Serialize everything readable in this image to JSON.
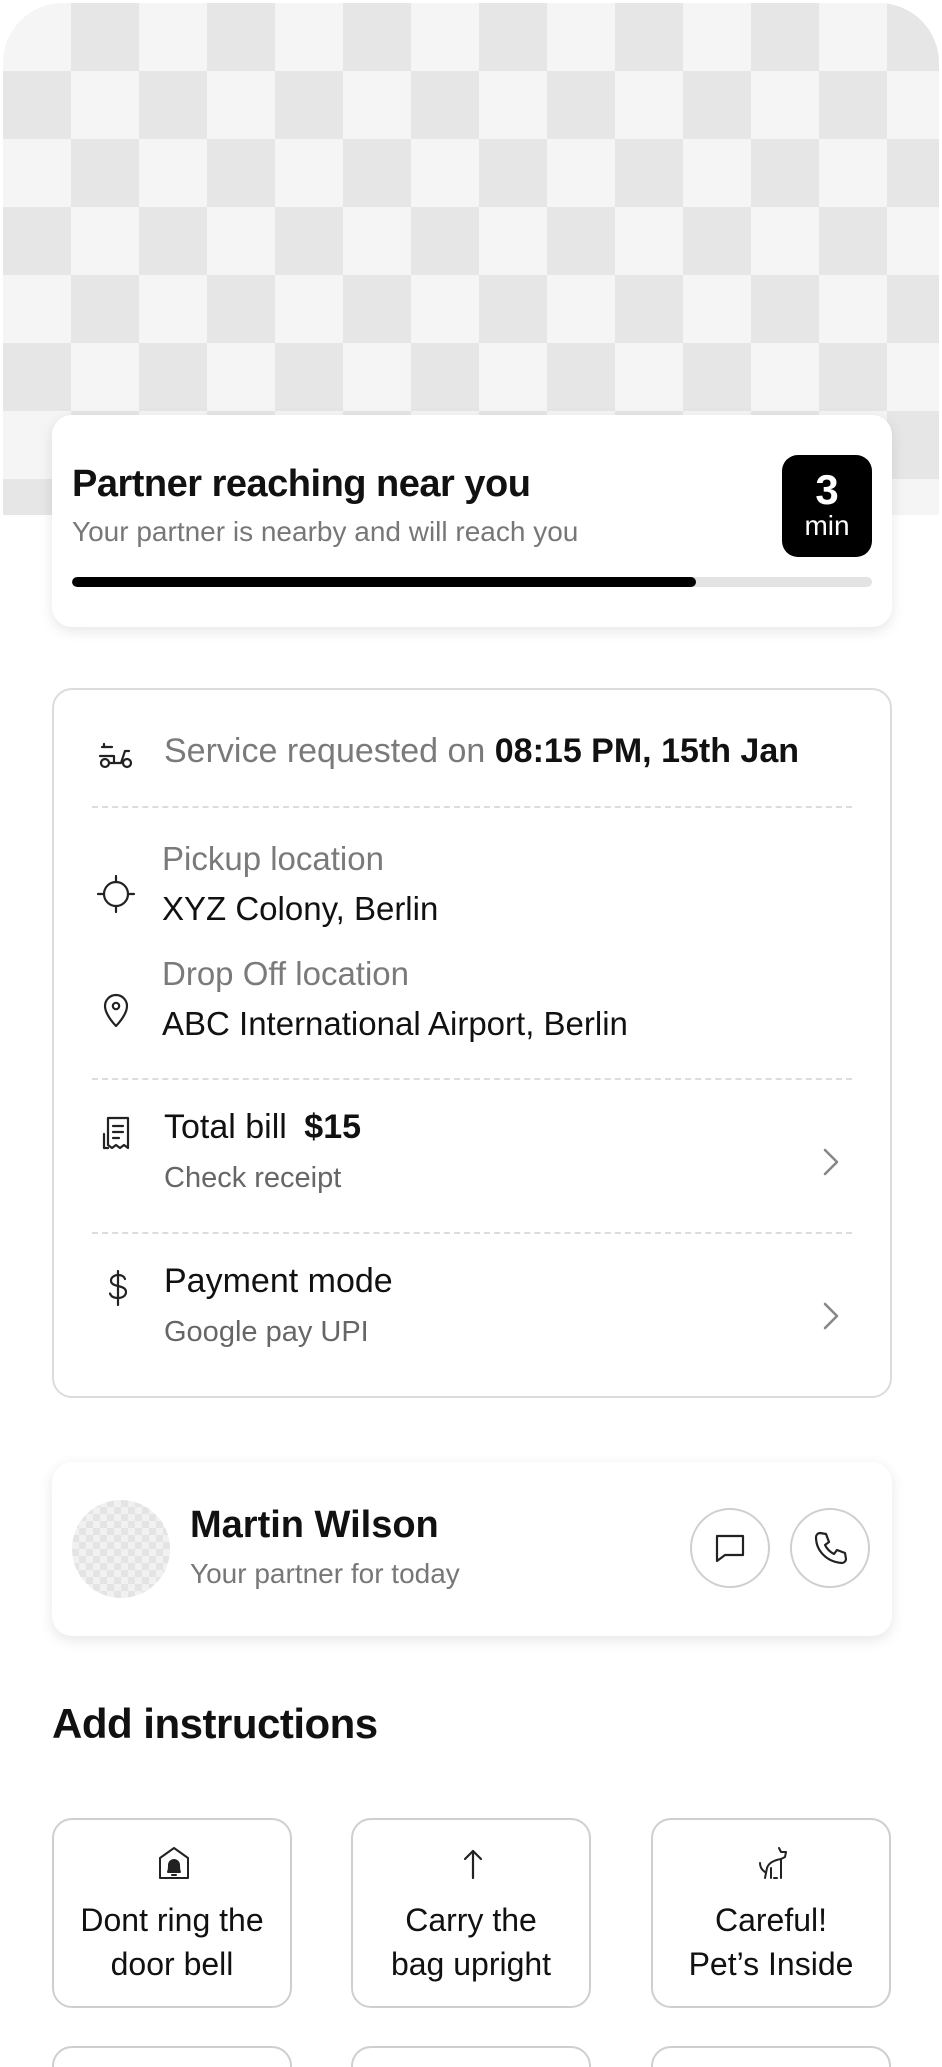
{
  "eta": {
    "title": "Partner reaching near you",
    "subtitle": "Your partner is nearby and will reach you",
    "minutes": "3",
    "unit": "min",
    "progress_percent": 78
  },
  "service": {
    "requested_prefix": "Service requested on",
    "requested_time": "08:15 PM, 15th Jan",
    "pickup_label": "Pickup location",
    "pickup_value": "XYZ Colony, Berlin",
    "dropoff_label": "Drop Off location",
    "dropoff_value": "ABC International Airport, Berlin",
    "bill_label": "Total bill",
    "bill_amount": "$15",
    "bill_link": "Check receipt",
    "payment_label": "Payment mode",
    "payment_value": "Google pay UPI"
  },
  "partner": {
    "name": "Martin Wilson",
    "subtitle": "Your partner for today"
  },
  "instructions": {
    "title": "Add instructions",
    "tiles": [
      {
        "line1": "Dont ring the",
        "line2": "door bell",
        "icon": "doorbell-icon"
      },
      {
        "line1": "Carry the",
        "line2": "bag upright",
        "icon": "arrow-up-icon"
      },
      {
        "line1": "Careful!",
        "line2": "Pet’s Inside",
        "icon": "dog-icon"
      }
    ]
  },
  "colors": {
    "accent": "#000000",
    "muted_text": "#777777",
    "border": "#dcdcdc"
  }
}
